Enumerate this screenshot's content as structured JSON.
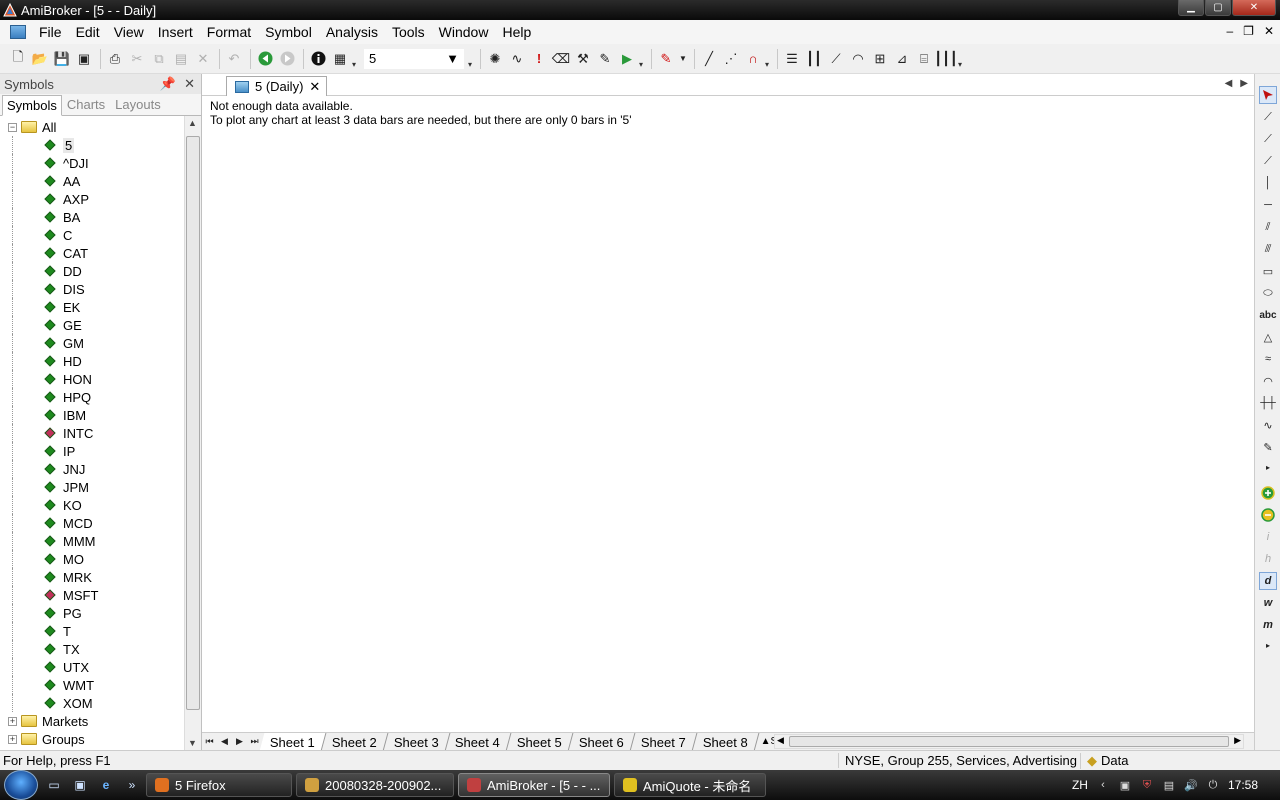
{
  "window": {
    "title": "AmiBroker - [5 -  - Daily]",
    "controls": {
      "minimize": "▁",
      "maximize": "▢",
      "close": "✕"
    }
  },
  "menubar": {
    "items": [
      {
        "label": "File"
      },
      {
        "label": "Edit"
      },
      {
        "label": "View"
      },
      {
        "label": "Insert"
      },
      {
        "label": "Format"
      },
      {
        "label": "Symbol"
      },
      {
        "label": "Analysis"
      },
      {
        "label": "Tools"
      },
      {
        "label": "Window"
      },
      {
        "label": "Help"
      }
    ],
    "mdi_controls": {
      "minimize": "–",
      "restore": "❐",
      "close": "✕"
    }
  },
  "toolbar": {
    "symbol_combo_value": "5"
  },
  "symbols_panel": {
    "title": "Symbols",
    "tabs": [
      {
        "label": "Symbols"
      },
      {
        "label": "Charts"
      },
      {
        "label": "Layouts"
      }
    ],
    "root_folder": "All",
    "symbols": [
      {
        "name": "5",
        "color": "#1e8a1e"
      },
      {
        "name": "^DJI",
        "color": "#1e8a1e"
      },
      {
        "name": "AA",
        "color": "#1e8a1e"
      },
      {
        "name": "AXP",
        "color": "#1e8a1e"
      },
      {
        "name": "BA",
        "color": "#1e8a1e"
      },
      {
        "name": "C",
        "color": "#1e8a1e"
      },
      {
        "name": "CAT",
        "color": "#1e8a1e"
      },
      {
        "name": "DD",
        "color": "#1e8a1e"
      },
      {
        "name": "DIS",
        "color": "#1e8a1e"
      },
      {
        "name": "EK",
        "color": "#1e8a1e"
      },
      {
        "name": "GE",
        "color": "#1e8a1e"
      },
      {
        "name": "GM",
        "color": "#1e8a1e"
      },
      {
        "name": "HD",
        "color": "#1e8a1e"
      },
      {
        "name": "HON",
        "color": "#1e8a1e"
      },
      {
        "name": "HPQ",
        "color": "#1e8a1e"
      },
      {
        "name": "IBM",
        "color": "#1e8a1e"
      },
      {
        "name": "INTC",
        "color": "#c0305a"
      },
      {
        "name": "IP",
        "color": "#1e8a1e"
      },
      {
        "name": "JNJ",
        "color": "#1e8a1e"
      },
      {
        "name": "JPM",
        "color": "#1e8a1e"
      },
      {
        "name": "KO",
        "color": "#1e8a1e"
      },
      {
        "name": "MCD",
        "color": "#1e8a1e"
      },
      {
        "name": "MMM",
        "color": "#1e8a1e"
      },
      {
        "name": "MO",
        "color": "#1e8a1e"
      },
      {
        "name": "MRK",
        "color": "#1e8a1e"
      },
      {
        "name": "MSFT",
        "color": "#c0305a"
      },
      {
        "name": "PG",
        "color": "#1e8a1e"
      },
      {
        "name": "T",
        "color": "#1e8a1e"
      },
      {
        "name": "TX",
        "color": "#1e8a1e"
      },
      {
        "name": "UTX",
        "color": "#1e8a1e"
      },
      {
        "name": "WMT",
        "color": "#1e8a1e"
      },
      {
        "name": "XOM",
        "color": "#1e8a1e"
      }
    ],
    "other_folders": [
      {
        "name": "Markets"
      },
      {
        "name": "Groups"
      }
    ]
  },
  "document": {
    "tab_label": "5 (Daily)",
    "message_line1": "Not enough data available.",
    "message_line2": "To plot any chart at least 3 data bars are needed, but there are only 0 bars in '5'"
  },
  "sheets": {
    "tabs": [
      {
        "label": "Sheet 1"
      },
      {
        "label": "Sheet 2"
      },
      {
        "label": "Sheet 3"
      },
      {
        "label": "Sheet 4"
      },
      {
        "label": "Sheet 5"
      },
      {
        "label": "Sheet 6"
      },
      {
        "label": "Sheet 7"
      },
      {
        "label": "Sheet 8"
      }
    ],
    "overflow": "S"
  },
  "statusbar": {
    "help": "For Help, press F1",
    "info": "NYSE, Group 255, Services, Advertising",
    "data": "Data"
  },
  "taskbar": {
    "tasks": [
      {
        "label": "5 Firefox",
        "active": false
      },
      {
        "label": "20080328-200902...",
        "active": false
      },
      {
        "label": "AmiBroker - [5 -  - ...",
        "active": true
      },
      {
        "label": "AmiQuote - 未命名",
        "active": false
      }
    ],
    "tray": {
      "lang": "ZH",
      "time": "17:58"
    }
  }
}
